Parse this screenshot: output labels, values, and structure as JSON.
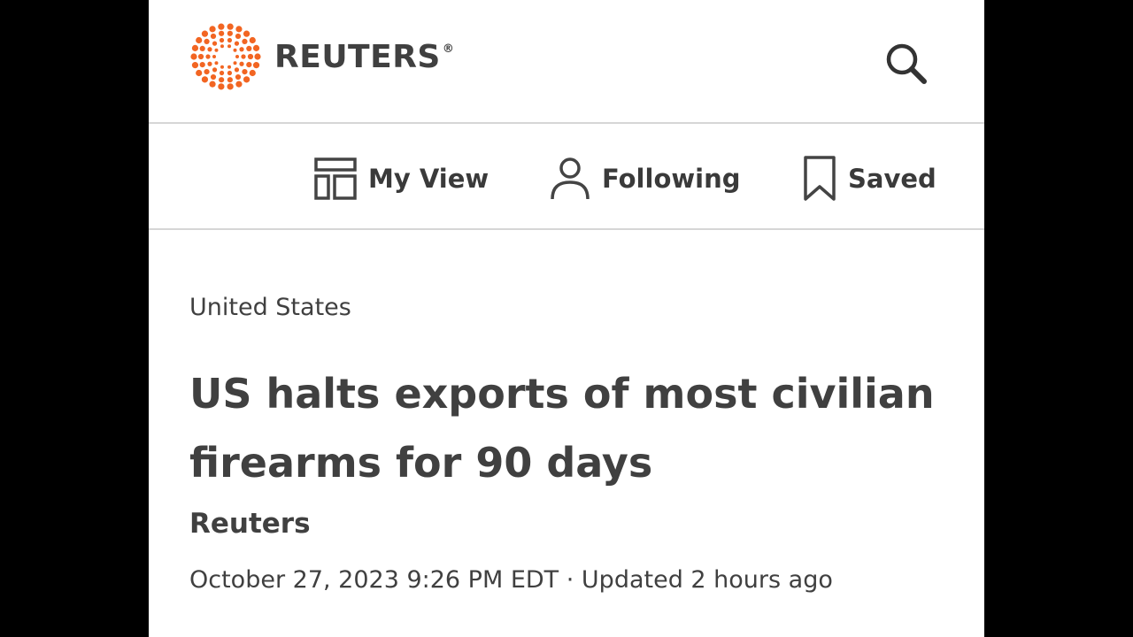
{
  "brand": {
    "name": "REUTERS",
    "registered": "®",
    "accent_color": "#f26522"
  },
  "header": {
    "search_icon": "search-icon"
  },
  "subnav": {
    "items": [
      {
        "label": "My View",
        "icon": "layout-icon"
      },
      {
        "label": "Following",
        "icon": "person-icon"
      },
      {
        "label": "Saved",
        "icon": "bookmark-icon"
      }
    ]
  },
  "article": {
    "section": "United States",
    "headline": "US halts exports of most civilian firearms for 90 days",
    "byline": "Reuters",
    "dateline": "October 27, 2023 9:26 PM EDT · Updated 2 hours ago"
  }
}
